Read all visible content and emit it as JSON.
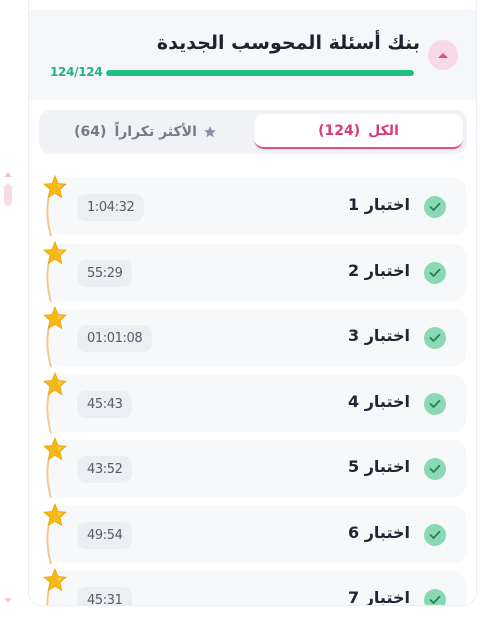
{
  "header": {
    "title": "بنك أسئلة المحوسب الجديدة",
    "progress_label": "124/124",
    "progress_fraction": 1.0,
    "collapse_icon": "chevron-up-icon"
  },
  "tabs": {
    "all": {
      "label": "الكل",
      "count": "(124)"
    },
    "frequent": {
      "label": "الأكثر تكراراً",
      "count": "(64)"
    }
  },
  "exams": [
    {
      "title": "اختبار 1",
      "time": "1:04:32"
    },
    {
      "title": "اختبار 2",
      "time": "55:29"
    },
    {
      "title": "اختبار 3",
      "time": "01:01:08"
    },
    {
      "title": "اختبار 4",
      "time": "45:43"
    },
    {
      "title": "اختبار 5",
      "time": "43:52"
    },
    {
      "title": "اختبار 6",
      "time": "49:54"
    },
    {
      "title": "اختبار 7",
      "time": "45:31"
    }
  ],
  "colors": {
    "accent_pink": "#d63b7d",
    "progress_green": "#1fbf86",
    "check_green": "#8ad9b5",
    "star_gold": "#f5b915"
  }
}
